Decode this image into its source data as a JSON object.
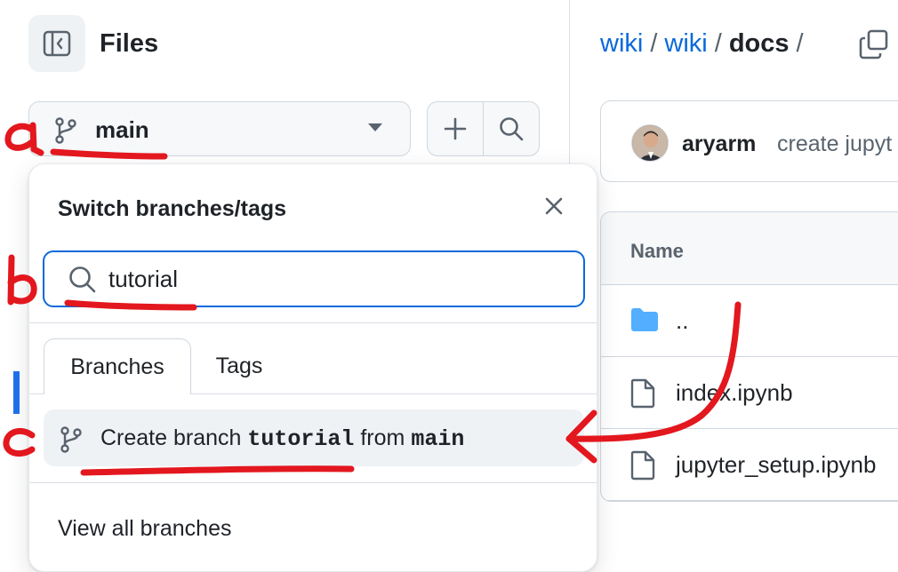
{
  "sidebar": {
    "title": "Files",
    "toggle_icon": "sidebar-collapse-icon"
  },
  "branch_selector": {
    "current_branch": "main",
    "icon": "git-branch-icon"
  },
  "actions": {
    "add_icon": "plus-icon",
    "search_icon": "search-icon"
  },
  "branch_dropdown": {
    "title": "Switch branches/tags",
    "search_value": "tutorial",
    "tabs": [
      {
        "label": "Branches",
        "active": true
      },
      {
        "label": "Tags",
        "active": false
      }
    ],
    "create_prefix": "Create branch ",
    "create_branch_name": "tutorial",
    "create_middle": " from ",
    "create_source": "main",
    "view_all": "View all branches"
  },
  "breadcrumb": {
    "parts": [
      "wiki",
      "wiki",
      "docs"
    ],
    "separator": "/"
  },
  "commit": {
    "author": "aryarm",
    "message": "create jupyt"
  },
  "file_table": {
    "header": "Name",
    "rows": [
      {
        "name": "..",
        "icon": "folder-icon"
      },
      {
        "name": "index.ipynb",
        "icon": "file-icon"
      },
      {
        "name": "jupyter_setup.ipynb",
        "icon": "file-icon"
      }
    ]
  },
  "annotations": {
    "labels": [
      "a",
      "b",
      "c"
    ],
    "color": "#e3171e"
  },
  "colors": {
    "accent": "#0969da",
    "annotation": "#e3171e"
  }
}
